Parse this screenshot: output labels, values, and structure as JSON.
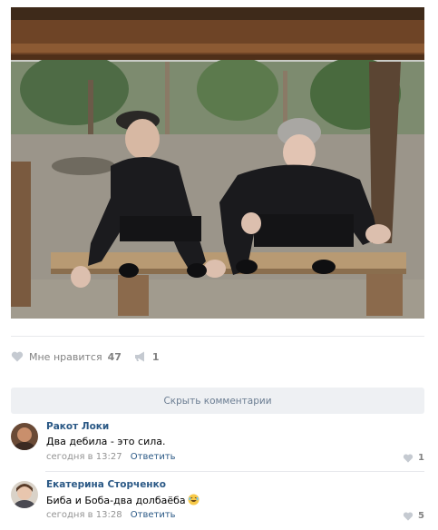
{
  "post": {
    "likes_label": "Мне нравится",
    "likes_count": "47",
    "shares_count": "1"
  },
  "comments_toggle": "Скрыть комментарии",
  "comments": [
    {
      "author": "Ракот Локи",
      "text": "Два дебила - это сила.",
      "time": "сегодня в 13:27",
      "reply": "Ответить",
      "likes": "1"
    },
    {
      "author": "Екатерина Сторченко",
      "text": "Биба и Боба-два долбаёба",
      "emoji": "laughing-face",
      "time": "сегодня в 13:28",
      "reply": "Ответить",
      "likes": "5"
    }
  ],
  "colors": {
    "link": "#2a5885",
    "muted": "#828282",
    "button_bg": "#eef0f3"
  }
}
